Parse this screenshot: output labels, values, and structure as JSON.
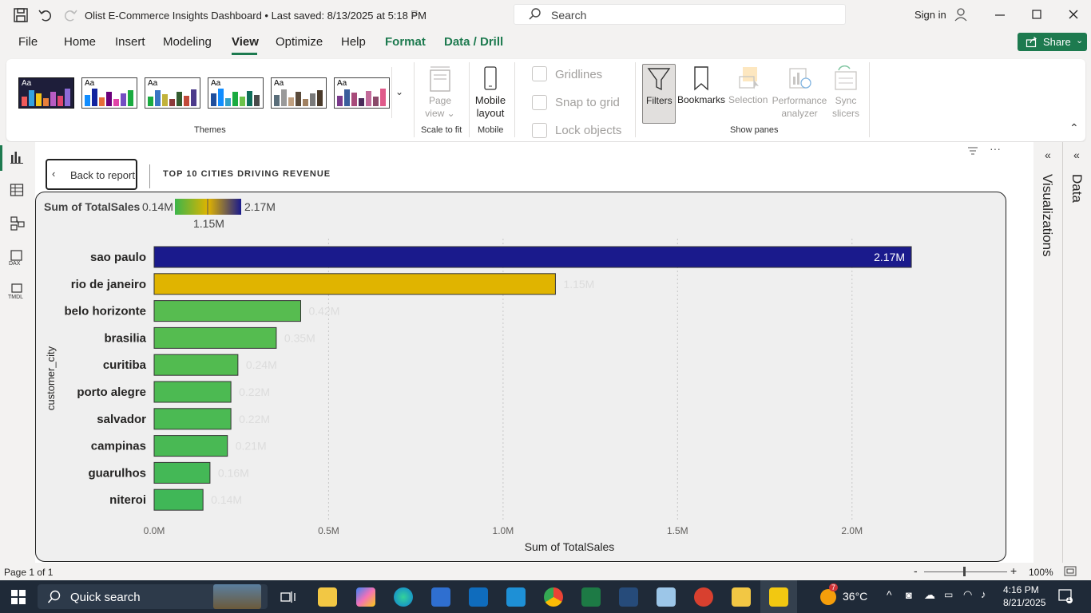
{
  "titlebar": {
    "doc_title": "Olist E-Commerce Insights Dashboard • Last saved: 8/13/2025 at 5:18 PM",
    "search_placeholder": "Search",
    "signin": "Sign in"
  },
  "menu": {
    "file": "File",
    "home": "Home",
    "insert": "Insert",
    "modeling": "Modeling",
    "view": "View",
    "optimize": "Optimize",
    "help": "Help",
    "format": "Format",
    "data_drill": "Data / Drill",
    "share": "Share",
    "accent_color": "#1d7a4f"
  },
  "ribbon": {
    "themes_label": "Themes",
    "theme_aa": "Aa",
    "page_view": "Page view",
    "scale_to_fit": "Scale to fit",
    "mobile_layout": "Mobile layout",
    "mobile_group": "Mobile",
    "gridlines": "Gridlines",
    "snap_to_grid": "Snap to grid",
    "lock_objects": "Lock objects",
    "filters": "Filters",
    "bookmarks": "Bookmarks",
    "selection": "Selection",
    "performance_analyzer": "Performance analyzer",
    "sync_slicers": "Sync slicers",
    "show_panes": "Show panes"
  },
  "canvas": {
    "back_to_report": "Back to report",
    "visual_title": "TOP 10 CITIES DRIVING REVENUE"
  },
  "chart_data": {
    "type": "bar",
    "orientation": "horizontal",
    "legend_title": "Sum of TotalSales",
    "legend_min": "0.14M",
    "legend_mid": "1.15M",
    "legend_max": "2.17M",
    "legend_colors": [
      "#3cb54a",
      "#e0b400",
      "#1a1a8c"
    ],
    "ylabel": "customer_city",
    "xlabel": "Sum of TotalSales",
    "xlim": [
      0,
      2.25
    ],
    "x_ticks": [
      "0.0M",
      "0.5M",
      "1.0M",
      "1.5M",
      "2.0M"
    ],
    "x_tick_values": [
      0,
      0.5,
      1.0,
      1.5,
      2.0
    ],
    "categories": [
      "sao paulo",
      "rio de janeiro",
      "belo horizonte",
      "brasilia",
      "curitiba",
      "porto alegre",
      "salvador",
      "campinas",
      "guarulhos",
      "niteroi"
    ],
    "values": [
      2.17,
      1.15,
      0.42,
      0.35,
      0.24,
      0.22,
      0.22,
      0.21,
      0.16,
      0.14
    ],
    "data_labels": [
      "2.17M",
      "1.15M",
      "0.42M",
      "0.35M",
      "0.24M",
      "0.22M",
      "0.22M",
      "0.21M",
      "0.16M",
      "0.14M"
    ],
    "bar_colors": [
      "#1a1a8c",
      "#e0b400",
      "#57bc50",
      "#55bc50",
      "#52bb50",
      "#4cba52",
      "#4bba53",
      "#49b954",
      "#44b856",
      "#40b757"
    ],
    "grid": true
  },
  "panes": {
    "visualizations": "Visualizations",
    "data": "Data"
  },
  "status": {
    "page": "Page 1 of 1",
    "zoom": "100%"
  },
  "taskbar": {
    "quick_search": "Quick search",
    "temperature": "36°C",
    "weather_badge": "7",
    "time": "4:16 PM",
    "date": "8/21/2025",
    "notification_count": "1"
  }
}
